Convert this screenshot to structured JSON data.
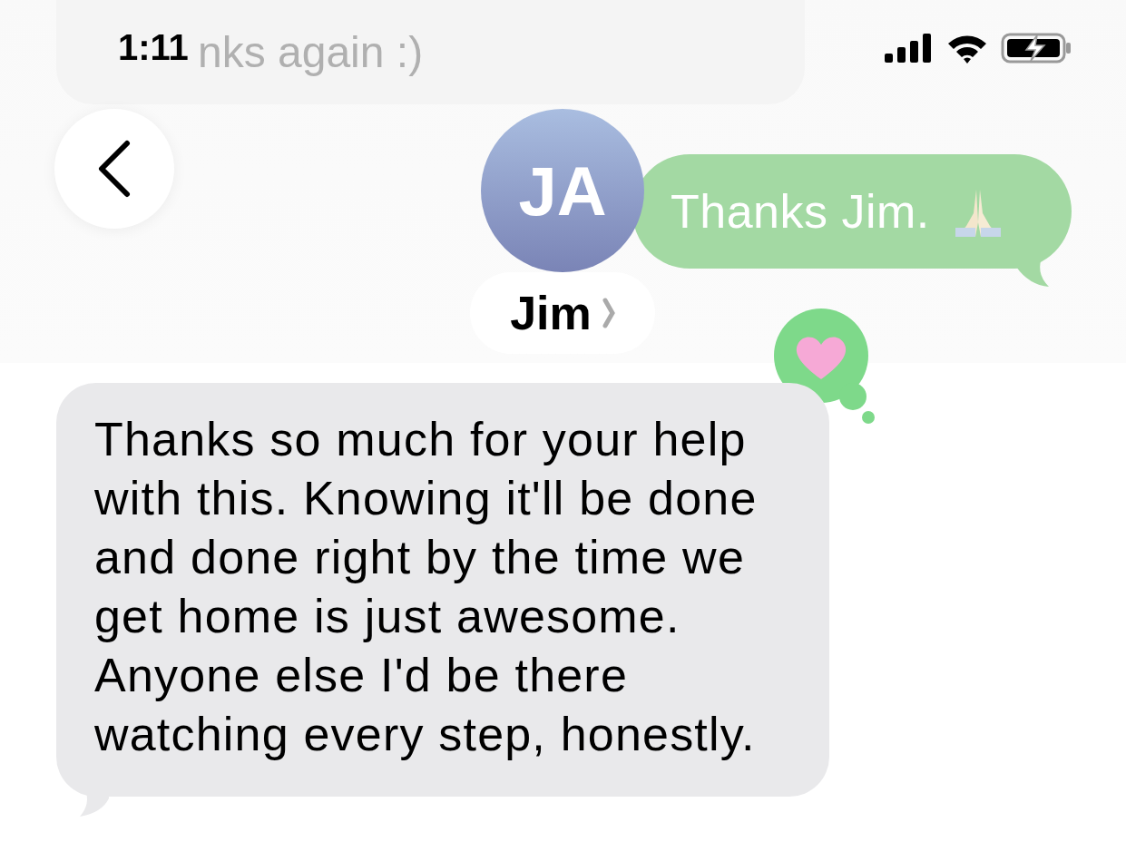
{
  "status_bar": {
    "time": "1:11"
  },
  "previous_message": {
    "text": "nks again :)"
  },
  "header": {
    "avatar_initials": "JA",
    "contact_name": "Jim"
  },
  "sent_message": {
    "text": "Thanks Jim.",
    "emoji": {
      "kind": "praying-hands"
    }
  },
  "reaction": {
    "kind": "heart"
  },
  "received_message": {
    "text": "Thanks so much for your help with this. Knowing it'll be done and done right by the time we get home is just awesome. Anyone else I'd be there watching every step, honestly."
  }
}
